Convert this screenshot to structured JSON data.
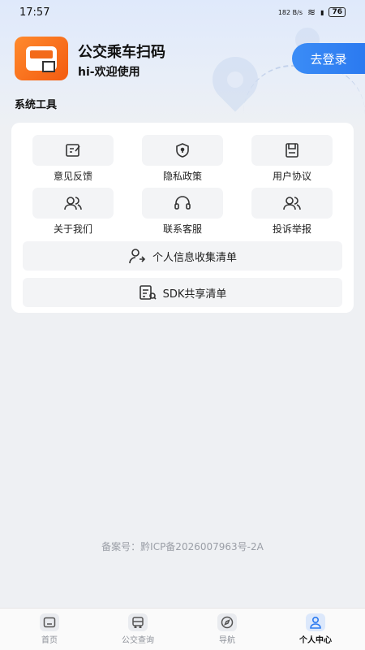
{
  "status_bar": {
    "time": "17:57",
    "network_speed": "182 B/s",
    "battery": "76"
  },
  "app": {
    "title": "公交乘车扫码",
    "subtitle": "hi-欢迎使用"
  },
  "login_button": "去登录",
  "section_title": "系统工具",
  "tools": [
    {
      "label": "意见反馈",
      "icon": "feedback-icon"
    },
    {
      "label": "隐私政策",
      "icon": "shield-icon"
    },
    {
      "label": "用户协议",
      "icon": "document-icon"
    },
    {
      "label": "关于我们",
      "icon": "users-icon"
    },
    {
      "label": "联系客服",
      "icon": "headset-icon"
    },
    {
      "label": "投诉举报",
      "icon": "users-icon"
    }
  ],
  "wide_buttons": [
    {
      "label": "个人信息收集清单",
      "icon": "user-list-icon"
    },
    {
      "label": "SDK共享清单",
      "icon": "sdk-list-icon"
    }
  ],
  "record_number": "备案号：黔ICP备2026007963号-2A",
  "tabs": [
    {
      "label": "首页",
      "icon": "home-icon"
    },
    {
      "label": "公交查询",
      "icon": "bus-icon"
    },
    {
      "label": "导航",
      "icon": "compass-icon"
    },
    {
      "label": "个人中心",
      "icon": "person-icon",
      "active": true
    }
  ],
  "colors": {
    "accent": "#2b7af0",
    "logo": "#f35b10",
    "background": "#eef0f3"
  }
}
